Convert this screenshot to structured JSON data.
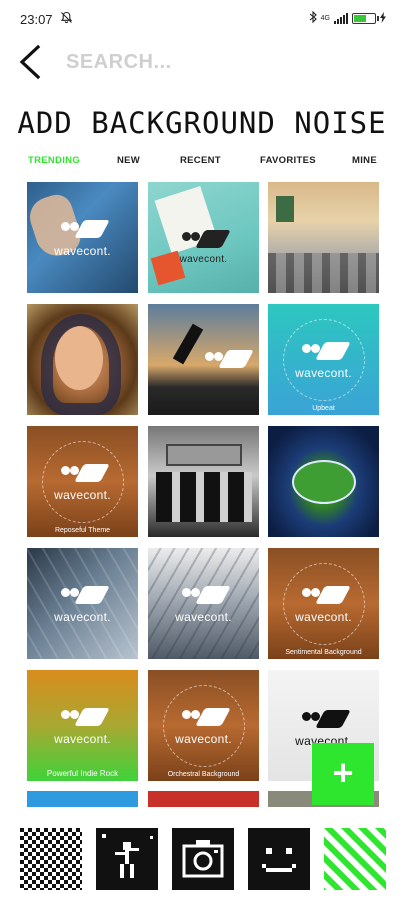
{
  "status": {
    "time": "23:07",
    "dnd_icon": "mute-notifications-icon",
    "bluetooth_icon": "bluetooth-icon",
    "network_label": "4G",
    "battery_level": 0.6,
    "charging_icon": "charging-bolt-icon"
  },
  "header": {
    "back_icon": "back-chevron-icon",
    "search_placeholder": "SEARCH..."
  },
  "title": "ADD BACKGROUND NOISE",
  "tabs": [
    {
      "label": "TRENDING",
      "active": true
    },
    {
      "label": "NEW",
      "active": false
    },
    {
      "label": "RECENT",
      "active": false
    },
    {
      "label": "FAVORITES",
      "active": false
    },
    {
      "label": "MINE",
      "active": false
    }
  ],
  "tiles": [
    {
      "logo_text": "wavecont.",
      "caption": ""
    },
    {
      "logo_text": "wavecont.",
      "caption": ""
    },
    {
      "logo_text": "",
      "caption": ""
    },
    {
      "logo_text": "",
      "caption": ""
    },
    {
      "logo_text": "",
      "caption": ""
    },
    {
      "logo_text": "wavecont.",
      "caption": "Upbeat"
    },
    {
      "logo_text": "wavecont.",
      "caption": "Reposeful Theme"
    },
    {
      "logo_text": "",
      "caption": ""
    },
    {
      "logo_text": "",
      "caption": ""
    },
    {
      "logo_text": "wavecont.",
      "caption": ""
    },
    {
      "logo_text": "wavecont.",
      "caption": ""
    },
    {
      "logo_text": "wavecont.",
      "caption": "Sentimental Background"
    },
    {
      "logo_text": "wavecont.",
      "caption": "Powerful Indie Rock"
    },
    {
      "logo_text": "wavecont.",
      "caption": "Orchestral Background"
    },
    {
      "logo_text": "wavecont.",
      "caption": ""
    }
  ],
  "fab": {
    "label": "+",
    "icon": "add-icon"
  },
  "bottom_bar": [
    {
      "icon": "checkerboard-icon"
    },
    {
      "icon": "dancing-figure-icon"
    },
    {
      "icon": "camera-icon"
    },
    {
      "icon": "smiley-face-icon"
    },
    {
      "icon": "green-stripes-icon"
    }
  ],
  "colors": {
    "accent": "#2ee62e"
  }
}
